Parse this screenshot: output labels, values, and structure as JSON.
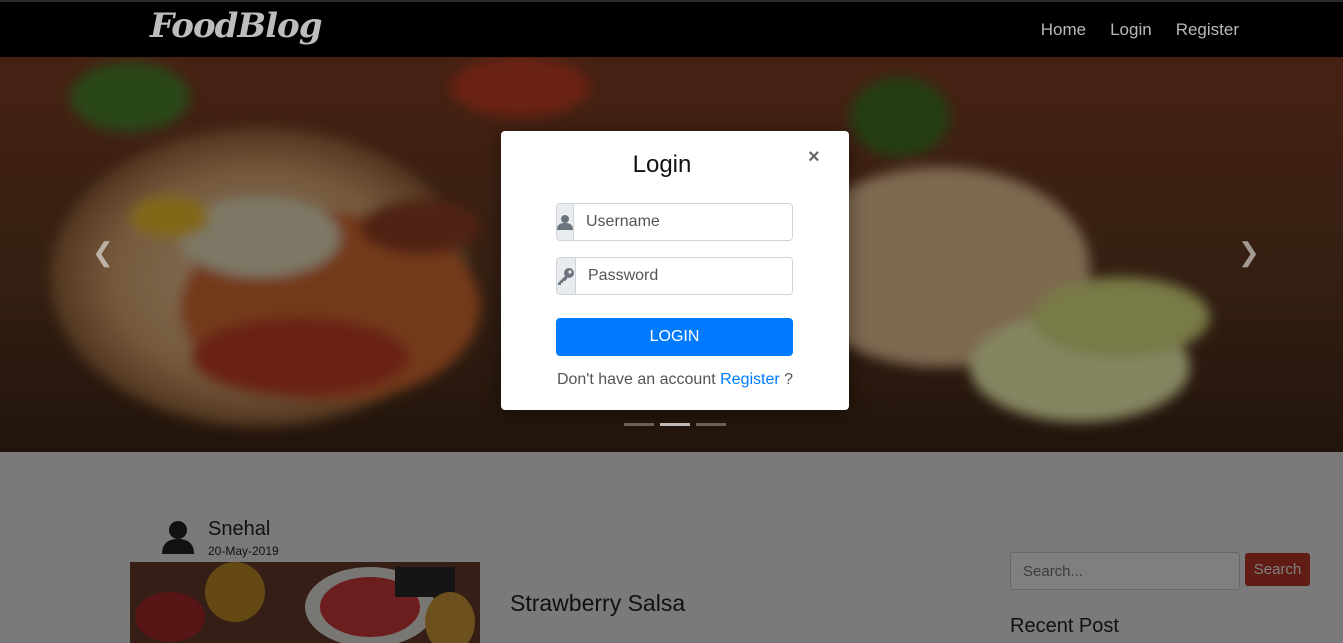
{
  "navbar": {
    "brand": "FoodBlog",
    "links": [
      "Home",
      "Login",
      "Register"
    ]
  },
  "carousel": {
    "indicator_count": 3,
    "active_index": 1
  },
  "modal": {
    "title": "Login",
    "close_symbol": "×",
    "username_placeholder": "Username",
    "password_placeholder": "Password",
    "submit_label": "LOGIN",
    "register_prompt": "Don't have an account",
    "register_link": "Register",
    "register_suffix": "?"
  },
  "post": {
    "author": "Snehal",
    "date": "20-May-2019",
    "title": "Strawberry Salsa"
  },
  "sidebar": {
    "search_placeholder": "Search...",
    "search_button": "Search",
    "recent_heading": "Recent Post"
  },
  "colors": {
    "primary": "#007bff",
    "search_button": "#c0392b",
    "navbar": "#000000"
  },
  "icons": {
    "username": "user-icon",
    "password": "key-icon",
    "author": "user-avatar-icon",
    "carousel_prev": "chevron-left-icon",
    "carousel_next": "chevron-right-icon"
  }
}
